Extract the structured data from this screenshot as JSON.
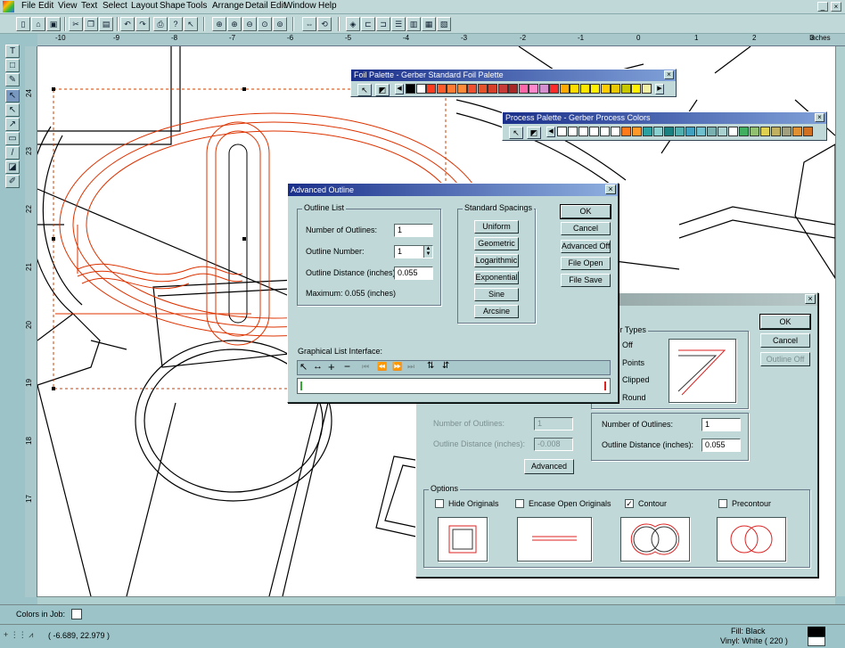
{
  "menu": [
    "File",
    "Edit",
    "View",
    "Text",
    "Select",
    "Layout",
    "Shape",
    "Tools",
    "Arrange",
    "Detail Edit",
    "Window",
    "Help"
  ],
  "window_controls": {
    "minimize": "_",
    "close": "×"
  },
  "ruler": {
    "horizontal": [
      "-10",
      "-9",
      "-8",
      "-7",
      "-6",
      "-5",
      "-4",
      "-3",
      "-2",
      "-1",
      "0",
      "1",
      "2",
      "3"
    ],
    "vertical": [
      "24",
      "23",
      "22",
      "21",
      "20",
      "19",
      "18",
      "17"
    ],
    "units": "Inches"
  },
  "foil_palette": {
    "title": "Foil Palette - Gerber Standard Foil Palette",
    "swatches": [
      "#000000",
      "#ffffff",
      "#ff3b1f",
      "#ff5a2a",
      "#ff7a32",
      "#ff8a3a",
      "#ef4f2f",
      "#e6532a",
      "#d6402a",
      "#c63a3a",
      "#a82828",
      "#ff66aa",
      "#ff88cc",
      "#d38fd0",
      "#ff2a2a",
      "#ffaa00",
      "#ffdd00",
      "#ffe600",
      "#fff000",
      "#ffcc00",
      "#e8c800",
      "#c8c800",
      "#ffef00",
      "#f0f0a0"
    ]
  },
  "process_palette": {
    "title": "Process Palette - Gerber Process Colors",
    "swatches": [
      "#ffffff",
      "#ffffff",
      "#ffffff",
      "#ffffff",
      "#ffffff",
      "#ffffff",
      "#ff7a1a",
      "#ff9a2a",
      "#2aa0a0",
      "#8ad0d0",
      "#1a8080",
      "#50b0b0",
      "#40a0c0",
      "#70c0d0",
      "#7ab0b0",
      "#aad0d0",
      "#ffffff",
      "#40b060",
      "#90c070",
      "#e0d050",
      "#c0b060",
      "#a0a080",
      "#e09030",
      "#d07020"
    ]
  },
  "advanced_outline": {
    "title": "Advanced Outline",
    "outline_list": {
      "label": "Outline List",
      "num_outlines_label": "Number of Outlines:",
      "num_outlines_value": "1",
      "outline_number_label": "Outline Number:",
      "outline_number_value": "1",
      "distance_label": "Outline Distance (inches):",
      "distance_value": "0.055",
      "maximum": "Maximum:  0.055 (inches)"
    },
    "spacings": {
      "label": "Standard Spacings",
      "buttons": [
        "Uniform",
        "Geometric",
        "Logarithmic",
        "Exponential",
        "Sine",
        "Arcsine"
      ]
    },
    "buttons": [
      "OK",
      "Cancel",
      "Advanced Off",
      "File Open",
      "File Save"
    ],
    "graphical_label": "Graphical List Interface:"
  },
  "outline_dialog": {
    "buttons": {
      "ok": "OK",
      "cancel": "Cancel",
      "outline_off": "Outline Off"
    },
    "corner_types": {
      "label": "Corner Types",
      "options": [
        "Off",
        "Points",
        "Clipped",
        "Round"
      ]
    },
    "left_num_label": "Number of Outlines:",
    "left_num_value": "1",
    "left_dist_label": "Outline Distance (inches):",
    "left_dist_value": "-0.008",
    "advanced_button": "Advanced",
    "right_num_label": "Number of Outlines:",
    "right_num_value": "1",
    "right_dist_label": "Outline Distance (inches):",
    "right_dist_value": "0.055",
    "options": {
      "label": "Options",
      "items": [
        {
          "label": "Hide Originals",
          "checked": false
        },
        {
          "label": "Encase Open Originals",
          "checked": false
        },
        {
          "label": "Contour",
          "checked": true
        },
        {
          "label": "Precontour",
          "checked": false
        }
      ]
    }
  },
  "status": {
    "colors_in_job": "Colors in Job:",
    "coordinates": "( -6.689, 22.979 )",
    "fill": "Fill: Black",
    "vinyl": "Vinyl: White ( 220 )"
  },
  "colors": {
    "accent": "#1a2f8a",
    "outline_red": "#dd3300",
    "ui_bg": "#c0d8d8"
  }
}
